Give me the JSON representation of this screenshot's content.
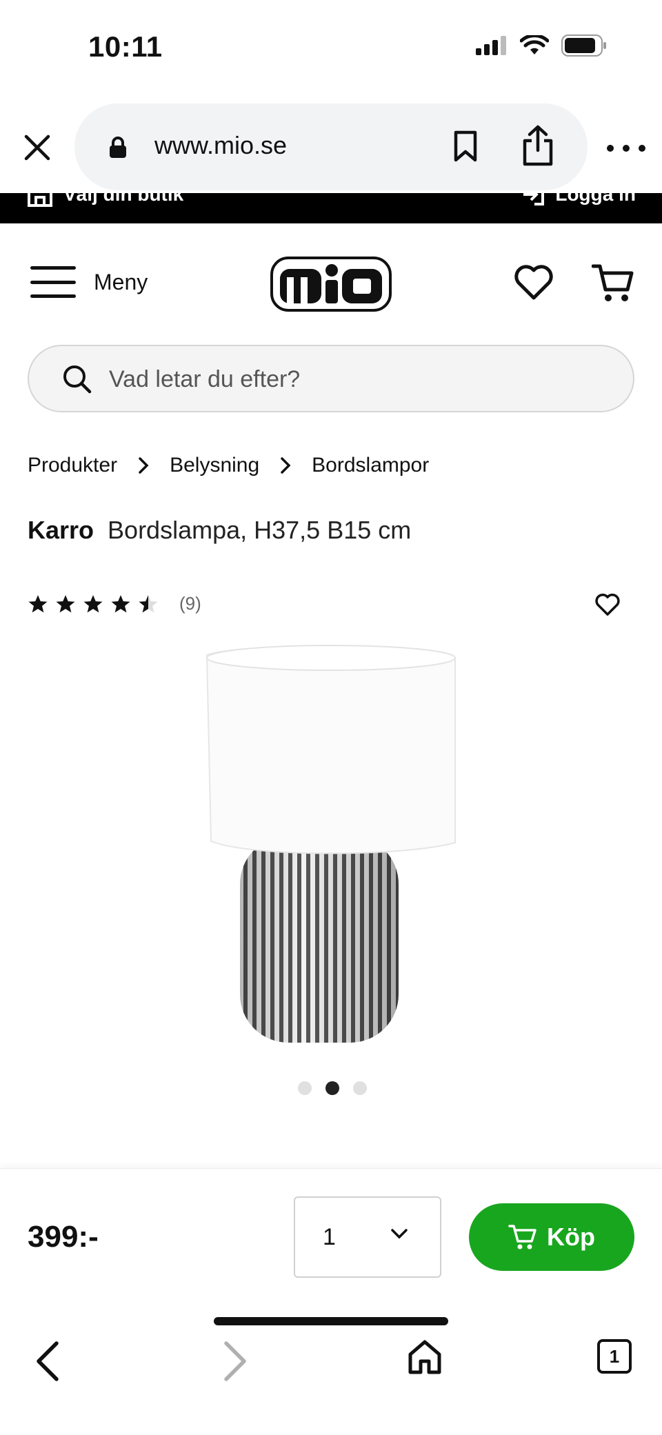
{
  "status_bar": {
    "time": "10:11"
  },
  "browser": {
    "url": "www.mio.se",
    "tab_count": "1"
  },
  "top_strip": {
    "store_label": "Välj din butik",
    "login_label": "Logga in"
  },
  "header": {
    "menu_label": "Meny",
    "logo_text": "mio"
  },
  "search": {
    "placeholder": "Vad letar du efter?"
  },
  "breadcrumb": [
    "Produkter",
    "Belysning",
    "Bordslampor"
  ],
  "product": {
    "brand": "Karro",
    "name": "Bordslampa, H37,5 B15 cm",
    "rating": 4.5,
    "rating_max": 5,
    "review_count": "(9)",
    "image_count": 3,
    "active_image": 2
  },
  "purchase": {
    "price": "399:-",
    "quantity": "1",
    "buy_label": "Köp"
  },
  "colors": {
    "buy_green": "#19a61f",
    "strip_black": "#000000"
  }
}
